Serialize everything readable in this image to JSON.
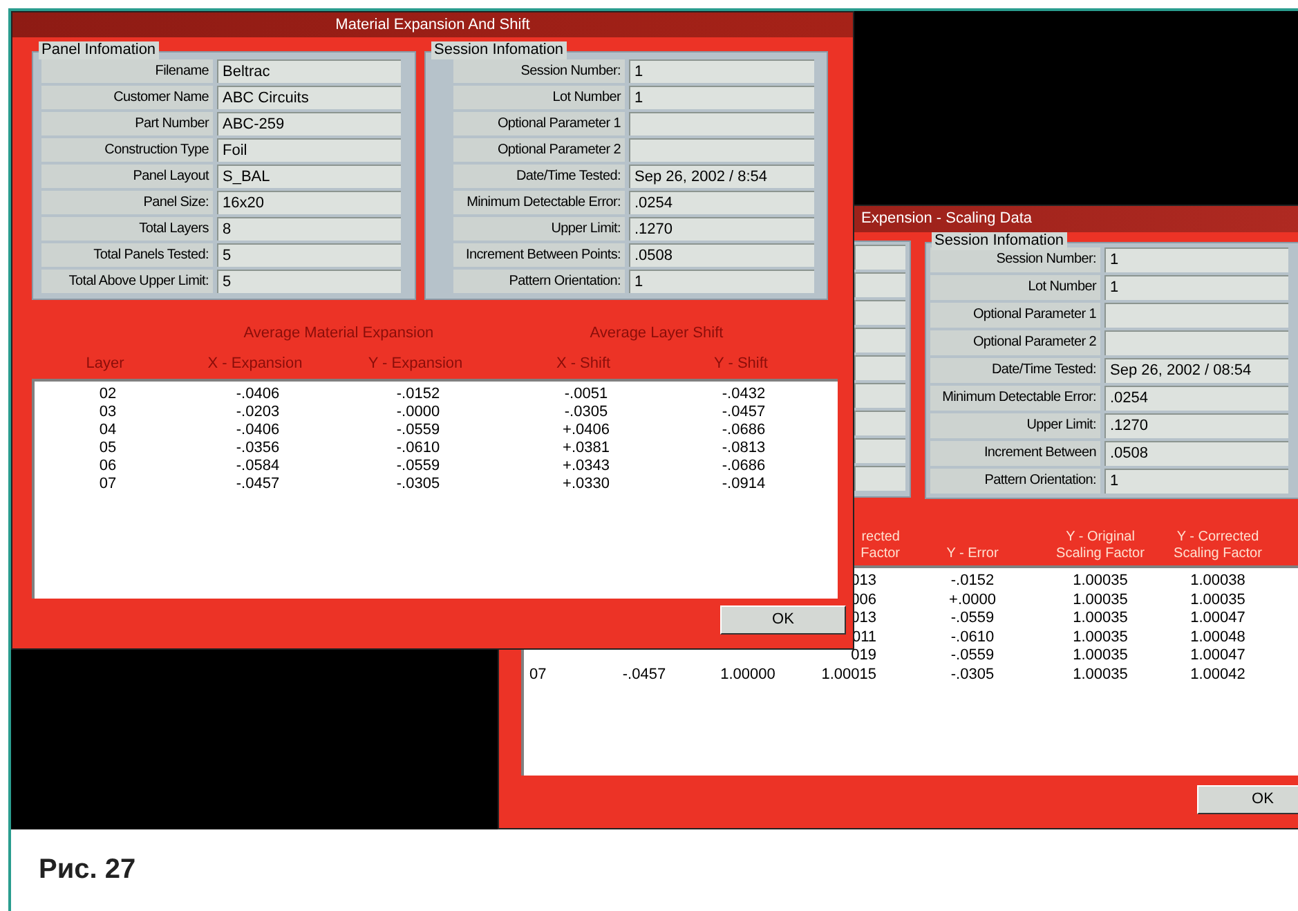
{
  "windows": [
    {
      "title": "Material Expansion And Shift",
      "panel_information": {
        "title": "Panel Infomation",
        "fields": [
          {
            "label": "Filename",
            "value": "Beltrac"
          },
          {
            "label": "Customer Name",
            "value": "ABC Circuits"
          },
          {
            "label": "Part Number",
            "value": "ABC-259"
          },
          {
            "label": "Construction Type",
            "value": "Foil"
          },
          {
            "label": "Panel Layout",
            "value": "S_BAL"
          },
          {
            "label": "Panel Size:",
            "value": "16x20"
          },
          {
            "label": "Total Layers",
            "value": "8"
          },
          {
            "label": "Total Panels Tested:",
            "value": "5"
          },
          {
            "label": "Total Above Upper Limit:",
            "value": "5"
          }
        ]
      },
      "session_information": {
        "title": "Session Infomation",
        "fields": [
          {
            "label": "Session Number:",
            "value": "1"
          },
          {
            "label": "Lot Number",
            "value": "1"
          },
          {
            "label": "Optional Parameter 1"
          },
          {
            "label": "Optional Parameter 2"
          },
          {
            "label": "Date/Time Tested:",
            "value": "Sep 26, 2002 / 8:54"
          },
          {
            "label": "Minimum Detectable Error:",
            "value": ".0254"
          },
          {
            "label": "Upper Limit:",
            "value": ".1270"
          },
          {
            "label": "Increment Between Points:",
            "value": ".0508"
          },
          {
            "label": "Pattern Orientation:",
            "value": "1"
          }
        ]
      },
      "table": {
        "group_headings": [
          "Average Material Expansion",
          "Average Layer Shift"
        ],
        "columns": [
          "Layer",
          "X - Expansion",
          "Y - Expansion",
          "X - Shift",
          "Y - Shift"
        ],
        "rows": [
          [
            "02",
            "-.0406",
            "-.0152",
            "-.0051",
            "-.0432"
          ],
          [
            "03",
            "-.0203",
            "-.0000",
            "-.0305",
            "-.0457"
          ],
          [
            "04",
            "-.0406",
            "-.0559",
            "+.0406",
            "-.0686"
          ],
          [
            "05",
            "-.0356",
            "-.0610",
            "+.0381",
            "-.0813"
          ],
          [
            "06",
            "-.0584",
            "-.0559",
            "+.0343",
            "-.0686"
          ],
          [
            "07",
            "-.0457",
            "-.0305",
            "+.0330",
            "-.0914"
          ]
        ]
      },
      "buttons": [
        "OK"
      ]
    },
    {
      "title": "Expension - Scaling Data",
      "session_information": {
        "title": "Session Infomation",
        "fields": [
          {
            "label": "Session Number:",
            "value": "1"
          },
          {
            "label": "Lot Number",
            "value": "1"
          },
          {
            "label": "Optional Parameter 1"
          },
          {
            "label": "Optional Parameter 2"
          },
          {
            "label": "Date/Time Tested:",
            "value": "Sep 26, 2002 / 08:54"
          },
          {
            "label": "Minimum Detectable Error:",
            "value": ".0254"
          },
          {
            "label": "Upper Limit:",
            "value": ".1270"
          },
          {
            "label": "Increment Between",
            "value": ".0508"
          },
          {
            "label": "Pattern Orientation:",
            "value": "1"
          }
        ]
      },
      "table": {
        "columns": [
          "",
          "",
          "",
          "rected\nFactor",
          "Y - Error",
          "Y - Original\nScaling Factor",
          "Y - Corrected\nScaling Factor"
        ],
        "rows": [
          [
            "",
            "",
            "",
            "013",
            "-.0152",
            "1.00035",
            "1.00038"
          ],
          [
            "",
            "",
            "",
            "006",
            "+.0000",
            "1.00035",
            "1.00035"
          ],
          [
            "",
            "",
            "",
            "013",
            "-.0559",
            "1.00035",
            "1.00047"
          ],
          [
            "",
            "",
            "",
            "011",
            "-.0610",
            "1.00035",
            "1.00048"
          ],
          [
            "",
            "",
            "",
            "019",
            "-.0559",
            "1.00035",
            "1.00047"
          ],
          [
            "07",
            "-.0457",
            "1.00000",
            "1.00015",
            "-.0305",
            "1.00035",
            "1.00042"
          ]
        ]
      },
      "buttons": [
        "OK"
      ]
    }
  ],
  "caption": "Рис. 27"
}
